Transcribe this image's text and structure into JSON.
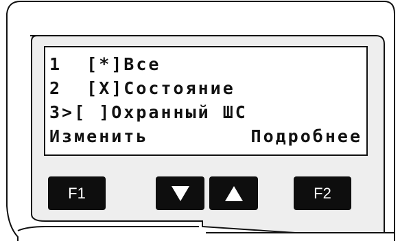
{
  "display": {
    "lines": [
      "1  [*]Все",
      "2  [X]Состояние",
      "3>[ ]Охранный ШС"
    ],
    "softkey_left": "Изменить",
    "softkey_right": "Подробнее"
  },
  "keys": {
    "f1_label": "F1",
    "f2_label": "F2",
    "down_icon": "triangle-down-icon",
    "up_icon": "triangle-up-icon"
  },
  "colors": {
    "panel_face": "#eeeeee",
    "key_fill": "#0e0e0e",
    "outline": "#111111",
    "lcd_background": "#ffffff"
  }
}
